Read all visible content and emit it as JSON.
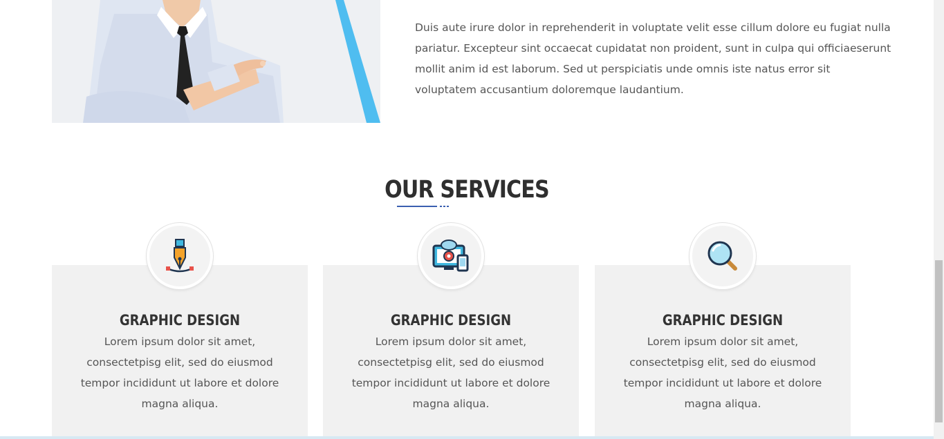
{
  "intro": {
    "paragraph": "Duis aute irure dolor in reprehenderit in voluptate velit esse cillum dolore eu fugiat nulla pariatur. Excepteur sint occaecat cupidatat non proident, sunt in culpa qui officiaeserunt mollit anim id est laborum. Sed ut perspiciatis unde omnis iste natus error sit voluptatem accusantium doloremque laudantium."
  },
  "services": {
    "title": "OUR SERVICES",
    "items": [
      {
        "icon": "pen-tool-icon",
        "title": "GRAPHIC DESIGN",
        "text": "Lorem ipsum dolor sit amet, consectetpisg elit, sed do eiusmod tempor incididunt ut labore et dolore magna aliqua."
      },
      {
        "icon": "devices-settings-icon",
        "title": "GRAPHIC DESIGN",
        "text": "Lorem ipsum dolor sit amet, consectetpisg elit, sed do eiusmod tempor incididunt ut labore et dolore magna aliqua."
      },
      {
        "icon": "magnifier-icon",
        "title": "GRAPHIC DESIGN",
        "text": "Lorem ipsum dolor sit amet, consectetpisg elit, sed do eiusmod tempor incididunt ut labore et dolore magna aliqua."
      }
    ]
  },
  "colors": {
    "accent_stripe": "#4fbdf0",
    "card_background": "#f1f1f1",
    "title_color": "#2f2f2f",
    "body_text": "#555555",
    "underline": "#3a5fb0"
  }
}
